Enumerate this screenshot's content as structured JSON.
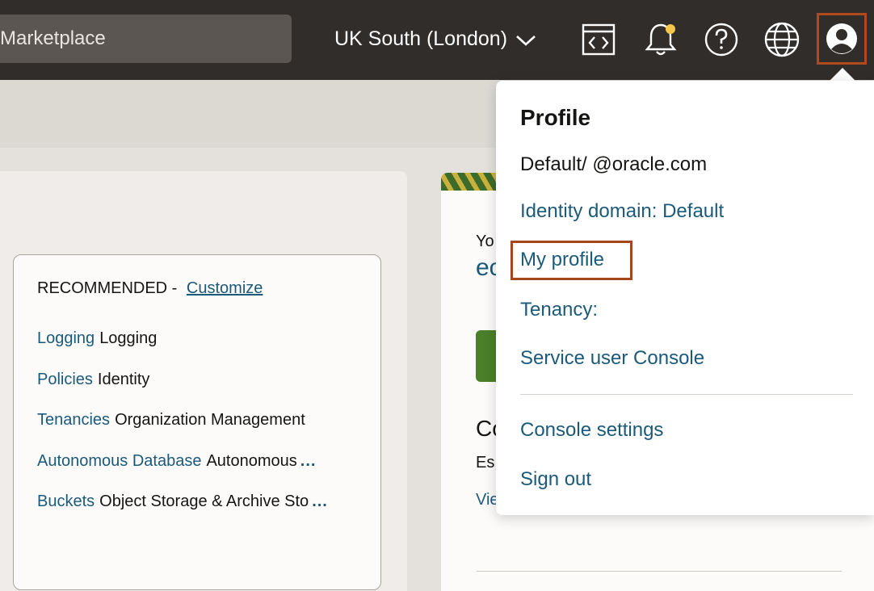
{
  "topbar": {
    "search_text": "Marketplace",
    "region_label": "UK South (London)",
    "icons": [
      "code-editor-icon",
      "bell-icon",
      "help-icon",
      "globe-icon",
      "profile-icon"
    ]
  },
  "recommended": {
    "heading": "RECOMMENDED -",
    "customize_label": "Customize",
    "items": [
      {
        "link": "Logging",
        "desc": "Logging",
        "more": ""
      },
      {
        "link": "Policies",
        "desc": "Identity",
        "more": ""
      },
      {
        "link": "Tenancies",
        "desc": "Organization Management",
        "more": ""
      },
      {
        "link": "Autonomous Database",
        "desc": "Autonomous",
        "more": "..."
      },
      {
        "link": "Buckets",
        "desc": "Object Storage & Archive Sto",
        "more": "..."
      }
    ]
  },
  "right_panel": {
    "you_text": "Yo",
    "big_text": "ec",
    "co_text": "Co",
    "es_text": "Es",
    "view_text": "Vie"
  },
  "profile_menu": {
    "title": "Profile",
    "user": "Default/            @oracle.com",
    "identity_domain": "Identity domain: Default",
    "my_profile": "My profile",
    "tenancy": "Tenancy:",
    "service_console": "Service user Console",
    "console_settings": "Console settings",
    "sign_out": "Sign out"
  },
  "colors": {
    "topbar_bg": "#312d2a",
    "link": "#1b5a7a",
    "highlight_border": "#a8461b"
  }
}
